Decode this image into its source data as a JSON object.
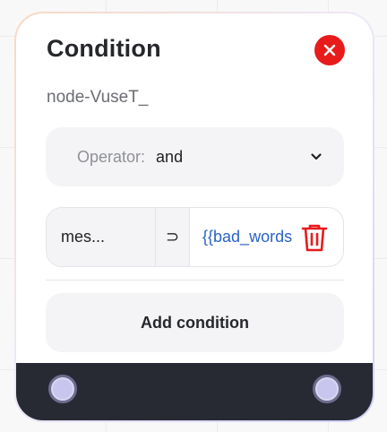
{
  "node": {
    "title": "Condition",
    "id_label": "node-VuseT_"
  },
  "operator": {
    "label": "Operator:",
    "value": "and"
  },
  "condition": {
    "field": "mes...",
    "op": "⊃",
    "value": "{{bad_words}}"
  },
  "add_button": {
    "label": "Add condition"
  },
  "icons": {
    "close": "close-icon",
    "chevron": "chevron-down-icon",
    "trash": "trash-icon"
  },
  "colors": {
    "close_red": "#e81b1b",
    "value_blue": "#2a62c8",
    "trash_red": "#e81b1b",
    "footer": "#272a33",
    "handle": "#c8c6ee"
  }
}
